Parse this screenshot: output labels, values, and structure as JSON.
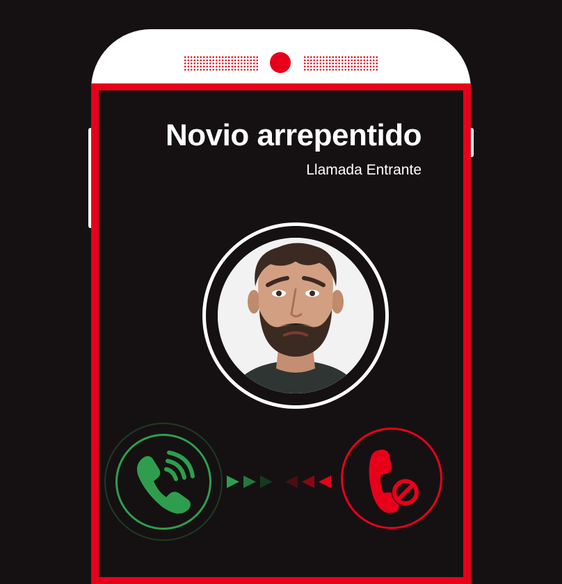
{
  "caller": {
    "name": "Novio arrepentido",
    "status": "Llamada Entrante"
  },
  "icons": {
    "accept": "phone-answer-icon",
    "decline": "phone-decline-icon"
  },
  "colors": {
    "background": "#151112",
    "accent_red": "#e8001b",
    "accept_green": "#2e9e4e",
    "phone_body": "#ffffff"
  }
}
